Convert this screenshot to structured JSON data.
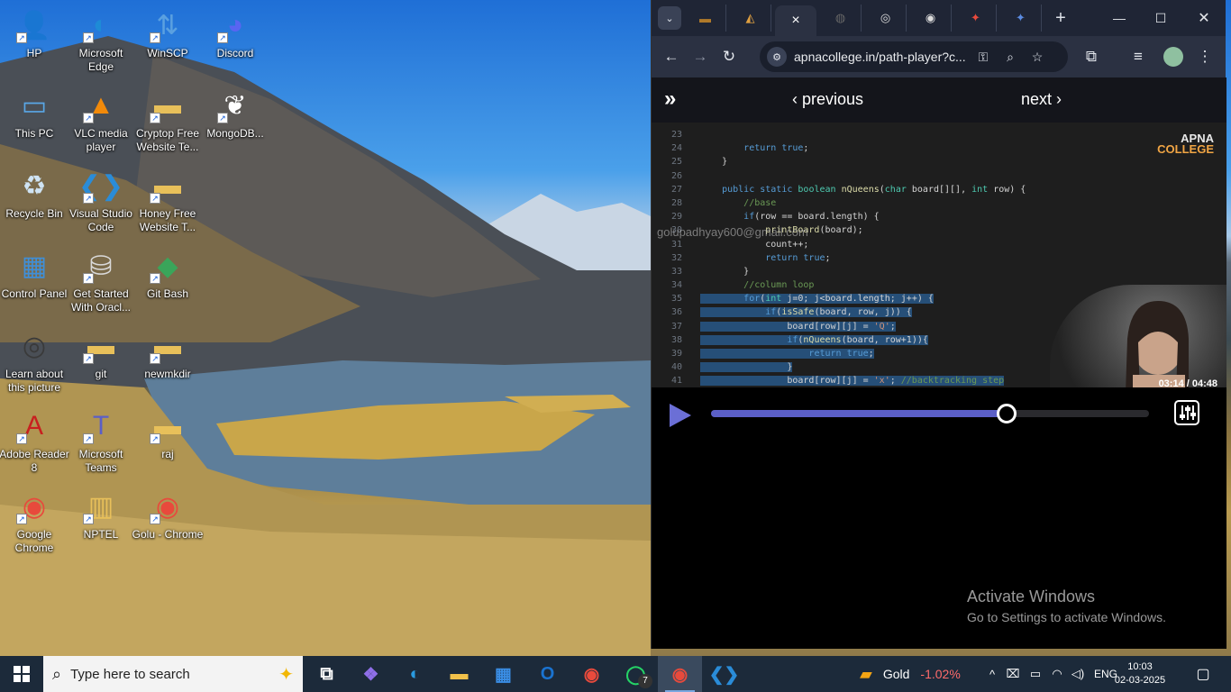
{
  "desktop": {
    "icons": [
      {
        "label": "HP",
        "icon": "user-folder-icon"
      },
      {
        "label": "Microsoft Edge",
        "icon": "edge-icon"
      },
      {
        "label": "WinSCP",
        "icon": "winscp-icon"
      },
      {
        "label": "Discord",
        "icon": "discord-icon"
      },
      {
        "label": "This PC",
        "icon": "computer-icon"
      },
      {
        "label": "VLC media player",
        "icon": "vlc-icon"
      },
      {
        "label": "Cryptop Free Website Te...",
        "icon": "folder-icon"
      },
      {
        "label": "MongoDB...",
        "icon": "mongodb-icon"
      },
      {
        "label": "Recycle Bin",
        "icon": "recycle-bin-icon"
      },
      {
        "label": "Visual Studio Code",
        "icon": "vscode-icon"
      },
      {
        "label": "Honey Free Website T...",
        "icon": "folder-icon"
      },
      {
        "label": "Control Panel",
        "icon": "control-panel-icon"
      },
      {
        "label": "Get Started With Oracl...",
        "icon": "oracle-db-icon"
      },
      {
        "label": "Git Bash",
        "icon": "git-bash-icon"
      },
      {
        "label": "Learn about this picture",
        "icon": "camera-icon"
      },
      {
        "label": "git",
        "icon": "folder-icon"
      },
      {
        "label": "newmkdir",
        "icon": "folder-icon"
      },
      {
        "label": "Adobe Reader 8",
        "icon": "adobe-reader-icon"
      },
      {
        "label": "Microsoft Teams",
        "icon": "teams-icon"
      },
      {
        "label": "raj",
        "icon": "folder-icon"
      },
      {
        "label": "Google Chrome",
        "icon": "chrome-icon"
      },
      {
        "label": "NPTEL",
        "icon": "zip-folder-icon"
      },
      {
        "label": "Golu - Chrome",
        "icon": "chrome-icon"
      }
    ]
  },
  "browser": {
    "tabs": [
      {
        "label": "",
        "icon": "tab-favicon"
      },
      {
        "label": "",
        "icon": "tab-favicon"
      },
      {
        "label": "×",
        "icon": "close-icon",
        "active": true
      },
      {
        "label": "",
        "icon": "tab-favicon"
      },
      {
        "label": "",
        "icon": "tab-favicon"
      },
      {
        "label": "",
        "icon": "tab-favicon"
      },
      {
        "label": "",
        "icon": "tab-favicon"
      },
      {
        "label": "",
        "icon": "tab-favicon"
      }
    ],
    "url": "apnacollege.in/path-player?c...",
    "colors": {
      "tabbar": "#1f2535",
      "toolbar": "#2b3142"
    }
  },
  "page": {
    "prev_label": "‹ previous",
    "next_label": "next ›",
    "watermark": "golupadhyay600@gmail.com",
    "logo_line1": "APNA",
    "logo_line2": "COLLEGE",
    "time": "03:14 / 04:48",
    "progress": 0.675,
    "accent": "#5b5fc7",
    "code_lines": [
      {
        "n": "23",
        "code": "",
        "sel": false
      },
      {
        "n": "24",
        "code": "        return true;",
        "sel": false
      },
      {
        "n": "25",
        "code": "    }",
        "sel": false
      },
      {
        "n": "26",
        "code": "",
        "sel": false
      },
      {
        "n": "27",
        "code": "    public static boolean nQueens(char board[][], int row) {",
        "sel": false
      },
      {
        "n": "28",
        "code": "        //base",
        "sel": false
      },
      {
        "n": "29",
        "code": "        if(row == board.length) {",
        "sel": false
      },
      {
        "n": "30",
        "code": "            printBoard(board);",
        "sel": false
      },
      {
        "n": "31",
        "code": "            count++;",
        "sel": false
      },
      {
        "n": "32",
        "code": "            return true;",
        "sel": false
      },
      {
        "n": "33",
        "code": "        }",
        "sel": false
      },
      {
        "n": "34",
        "code": "        //column loop",
        "sel": false
      },
      {
        "n": "35",
        "code": "        for(int j=0; j<board.length; j++) {",
        "sel": true
      },
      {
        "n": "36",
        "code": "            if(isSafe(board, row, j)) {",
        "sel": true
      },
      {
        "n": "37",
        "code": "                board[row][j] = 'Q';",
        "sel": true
      },
      {
        "n": "38",
        "code": "                if(nQueens(board, row+1)){",
        "sel": true
      },
      {
        "n": "39",
        "code": "                    return true;",
        "sel": true
      },
      {
        "n": "40",
        "code": "                }",
        "sel": true
      },
      {
        "n": "41",
        "code": "                board[row][j] = 'x'; //backtracking step",
        "sel": true
      }
    ]
  },
  "activation": {
    "title": "Activate Windows",
    "subtitle": "Go to Settings to activate Windows."
  },
  "taskbar": {
    "search_placeholder": "Type here to search",
    "apps": [
      {
        "icon": "task-view-icon"
      },
      {
        "icon": "copilot-icon"
      },
      {
        "icon": "edge-icon"
      },
      {
        "icon": "file-explorer-icon"
      },
      {
        "icon": "microsoft-store-icon"
      },
      {
        "icon": "outlook-icon"
      },
      {
        "icon": "chrome-icon"
      },
      {
        "icon": "whatsapp-icon",
        "badge": "7"
      },
      {
        "icon": "chrome-profile-icon",
        "active": true
      },
      {
        "icon": "vscode-icon"
      }
    ],
    "gold_label": "Gold",
    "gold_change": "-1.02%",
    "language": "ENG",
    "time": "10:03",
    "date": "02-03-2025"
  }
}
